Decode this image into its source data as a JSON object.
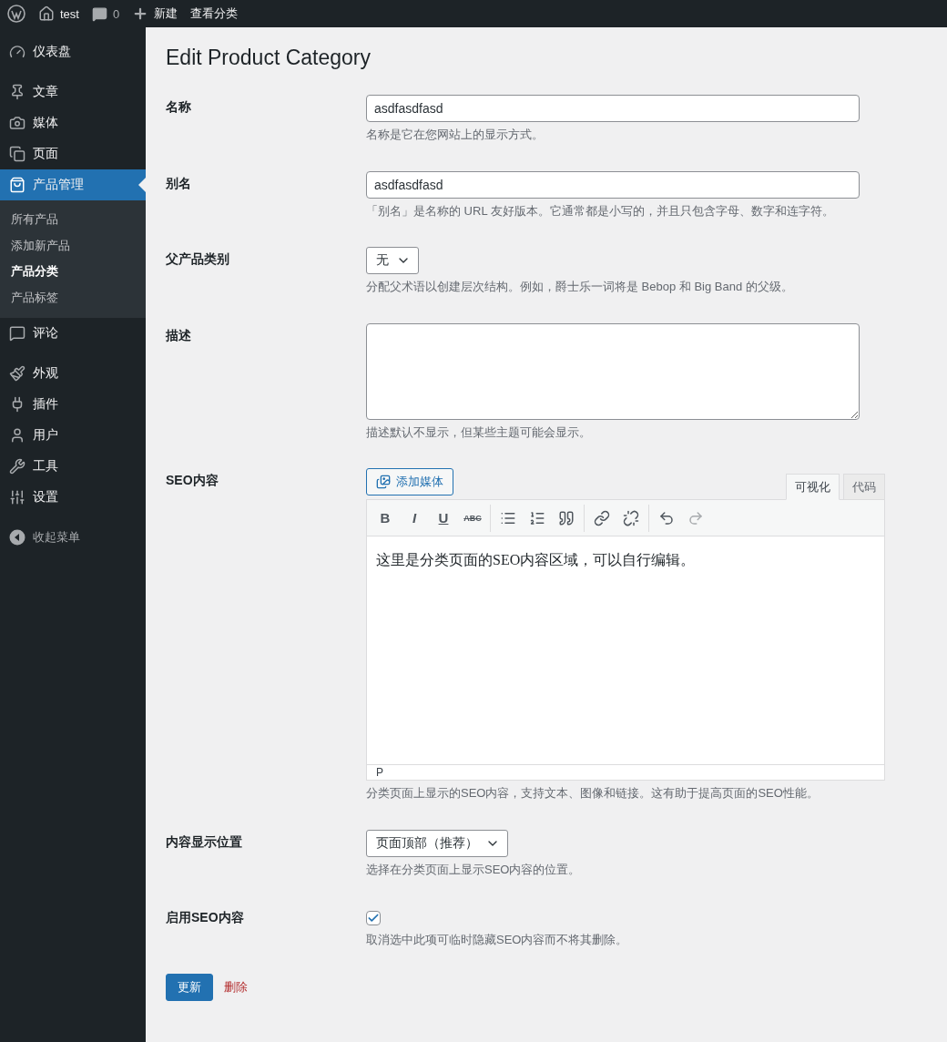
{
  "admin_bar": {
    "site": "test",
    "comments": "0",
    "new": "新建",
    "view": "查看分类"
  },
  "sidebar": {
    "groups": [
      [
        {
          "label": "仪表盘",
          "selected": false
        }
      ],
      [
        {
          "label": "文章",
          "selected": false
        },
        {
          "label": "媒体",
          "selected": false
        },
        {
          "label": "页面",
          "selected": false
        },
        {
          "label": "产品管理",
          "selected": true,
          "children": [
            {
              "label": "所有产品",
              "selected": false
            },
            {
              "label": "添加新产品",
              "selected": false
            },
            {
              "label": "产品分类",
              "selected": true
            },
            {
              "label": "产品标签",
              "selected": false
            }
          ]
        },
        {
          "label": "评论",
          "selected": false
        }
      ],
      [
        {
          "label": "外观",
          "selected": false
        },
        {
          "label": "插件",
          "selected": false
        },
        {
          "label": "用户",
          "selected": false
        },
        {
          "label": "工具",
          "selected": false
        },
        {
          "label": "设置",
          "selected": false
        }
      ]
    ],
    "collapse": "收起菜单"
  },
  "page_title": "Edit Product Category",
  "fields": [
    {
      "kind": "text",
      "label": "名称",
      "value": "asdfasdfasd",
      "description": "名称是它在您网站上的显示方式。"
    },
    {
      "kind": "text",
      "label": "别名",
      "value": "asdfasdfasd",
      "description": "「别名」是名称的 URL 友好版本。它通常都是小写的，并且只包含字母、数字和连字符。"
    },
    {
      "kind": "select",
      "label": "父产品类别",
      "value": "无",
      "description": "分配父术语以创建层次结构。例如，爵士乐一词将是 Bebop 和 Big Band 的父级。"
    },
    {
      "kind": "textarea",
      "label": "描述",
      "description": "描述默认不显示，但某些主题可能会显示。"
    },
    {
      "kind": "editor",
      "label": "SEO内容",
      "media_button": "添加媒体",
      "tabs": [
        {
          "label": "可视化",
          "selected": true
        },
        {
          "label": "代码",
          "selected": false
        }
      ],
      "format_buttons": [
        "B",
        "I",
        "U",
        "ABC"
      ],
      "redo_disabled": true,
      "content": "这里是分类页面的SEO内容区域，可以自行编辑。",
      "path": "P",
      "description": "分类页面上显示的SEO内容，支持文本、图像和链接。这有助于提高页面的SEO性能。"
    },
    {
      "kind": "select",
      "label": "内容显示位置",
      "value": "页面顶部（推荐）",
      "description": "选择在分类页面上显示SEO内容的位置。"
    },
    {
      "kind": "checkbox",
      "label": "启用SEO内容",
      "checked": true,
      "description": "取消选中此项可临时隐藏SEO内容而不将其删除。"
    }
  ],
  "actions": {
    "update": "更新",
    "delete": "删除"
  }
}
